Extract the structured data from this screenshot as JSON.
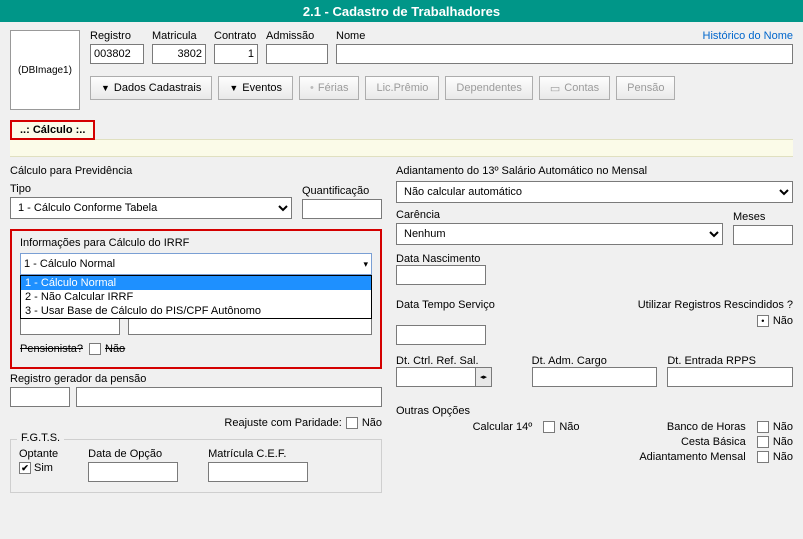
{
  "title": "2.1 - Cadastro de Trabalhadores",
  "thumb": "(DBImage1)",
  "header": {
    "registro_label": "Registro",
    "registro_value": "003802",
    "matricula_label": "Matricula",
    "matricula_value": "3802",
    "contrato_label": "Contrato",
    "contrato_value": "1",
    "admissao_label": "Admissão",
    "admissao_value": "",
    "nome_label": "Nome",
    "nome_value": "",
    "historico": "Histórico do Nome"
  },
  "buttons": {
    "dados": "Dados Cadastrais",
    "eventos": "Eventos",
    "ferias": "Férias",
    "licpremio": "Lic.Prêmio",
    "dependentes": "Dependentes",
    "contas": "Contas",
    "pensao": "Pensão"
  },
  "calc_tab": "..: Cálculo :..",
  "left": {
    "prev_title": "Cálculo para Previdência",
    "tipo_label": "Tipo",
    "tipo_value": "1 - Cálculo Conforme Tabela",
    "quant_label": "Quantificação",
    "quant_value": "",
    "irrf_title": "Informações para Cálculo do IRRF",
    "irrf_selected": "1 - Cálculo Normal",
    "irrf_options": [
      "1 - Cálculo Normal",
      "2 - Não Calcular IRRF",
      "3 - Usar Base de Cálculo do PIS/CPF Autônomo"
    ],
    "pensionista_label": "Pensionista?",
    "pensionista_value": "Não",
    "reg_pensao_label": "Registro gerador da pensão",
    "reajuste_label": "Reajuste com Paridade:",
    "reajuste_value": "Não",
    "fgts_legend": "F.G.T.S.",
    "optante_label": "Optante",
    "optante_value": "Sim",
    "data_opcao_label": "Data de Opção",
    "matricula_cef_label": "Matrícula C.E.F."
  },
  "right": {
    "adiant_title": "Adiantamento do 13º Salário Automático no Mensal",
    "adiant_value": "Não calcular automático",
    "carencia_label": "Carência",
    "carencia_value": "Nenhum",
    "meses_label": "Meses",
    "meses_value": "",
    "data_nasc_label": "Data Nascimento",
    "data_tempo_label": "Data Tempo Serviço",
    "util_reg_label": "Utilizar Registros Rescindidos ?",
    "util_reg_value": "Não",
    "dt_ctrl_label": "Dt. Ctrl. Ref. Sal.",
    "dt_adm_label": "Dt. Adm. Cargo",
    "dt_rpps_label": "Dt. Entrada RPPS",
    "outras_label": "Outras Opções",
    "calc14_label": "Calcular 14º",
    "calc14_value": "Não",
    "banco_label": "Banco de Horas",
    "banco_value": "Não",
    "cesta_label": "Cesta Básica",
    "cesta_value": "Não",
    "adiant_mensal_label": "Adiantamento Mensal",
    "adiant_mensal_value": "Não"
  }
}
